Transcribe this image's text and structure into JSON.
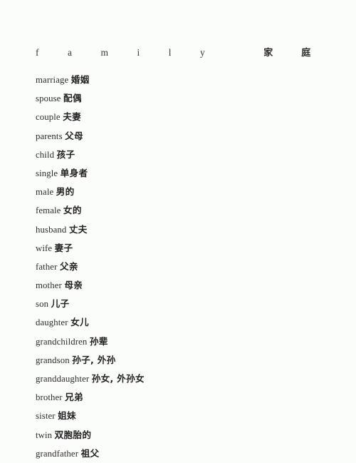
{
  "page": {
    "background_color": "#fbfdfa",
    "text_color": "#2e2e2e"
  },
  "heading": {
    "latin": "family",
    "han": "家庭"
  },
  "entries": [
    {
      "en": "marriage",
      "zh": "婚姻"
    },
    {
      "en": "spouse",
      "zh": "配偶"
    },
    {
      "en": "couple",
      "zh": "夫妻"
    },
    {
      "en": "parents",
      "zh": "父母"
    },
    {
      "en": "child",
      "zh": "孩子"
    },
    {
      "en": "single",
      "zh": "单身者"
    },
    {
      "en": "male",
      "zh": "男的"
    },
    {
      "en": "female",
      "zh": "女的"
    },
    {
      "en": "husband",
      "zh": "丈夫"
    },
    {
      "en": "wife",
      "zh": "妻子"
    },
    {
      "en": "father",
      "zh": "父亲"
    },
    {
      "en": "mother",
      "zh": "母亲"
    },
    {
      "en": "son",
      "zh": "儿子"
    },
    {
      "en": "daughter",
      "zh": "女儿"
    },
    {
      "en": "grandchildren",
      "zh": "孙辈"
    },
    {
      "en": "grandson",
      "zh": "孙子, 外孙"
    },
    {
      "en": "granddaughter",
      "zh": "孙女, 外孙女"
    },
    {
      "en": "brother",
      "zh": "兄弟"
    },
    {
      "en": "sister",
      "zh": "姐妹"
    },
    {
      "en": "twin",
      "zh": "双胞胎的"
    },
    {
      "en": "grandfather",
      "zh": "祖父"
    }
  ]
}
